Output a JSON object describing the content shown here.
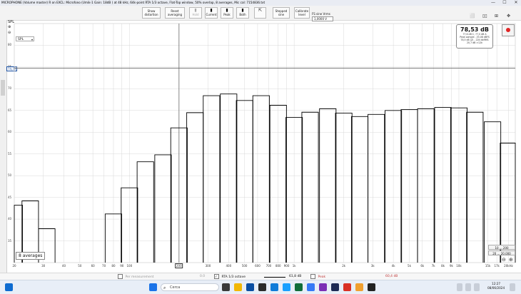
{
  "window": {
    "title": "MICROPHONE (Volume master) R on EXCL: Microfono (Umik-1 Gain: 18dB ) at 48 kHz, 64k-point RTA 1/3 octave, Flat-Top window, 50% overlap, 8 averages, Mic cal: 7154836.txt"
  },
  "toolbar": {
    "show_distortion": "Show distortion",
    "reset_averaging": "Reset averaging",
    "hold": "Hold",
    "current": "Current",
    "peak": "Peak",
    "both": "Both",
    "stepped_sine": "Stepped sine",
    "calibrate_level": "Calibrate level",
    "fs_sine_label": "FS sine Vrms",
    "fs_sine_value": "1,0000 V"
  },
  "axis": {
    "y_unit": "SPL",
    "y_ticks": [
      "80",
      "75",
      "70",
      "65",
      "60",
      "55",
      "50",
      "45",
      "40",
      "35"
    ],
    "x_ticks": [
      "20",
      "30",
      "40",
      "50",
      "60",
      "70",
      "80",
      "90",
      "100",
      "200",
      "300",
      "400",
      "500",
      "600",
      "700",
      "800",
      "900",
      "1k",
      "2k",
      "3k",
      "4k",
      "5k",
      "6k",
      "7k",
      "8k",
      "9k",
      "10k",
      "15k",
      "17k",
      "20kHz"
    ],
    "x_highlight": "200",
    "cursor_value": "74,72"
  },
  "overlay": {
    "averages": "8 averages",
    "readout_main": "78,53 dB",
    "readout_line1": "77,6 dB C, 77,0 dB A",
    "readout_line2": "Peak sample: -33,08 dBFS",
    "readout_line3": "78,5 dB (Z) - 22k dbRMS",
    "readout_line4": "20,7 dB >12k",
    "range1": "10 ... 200",
    "range2": "20 ... 20.000"
  },
  "legend": {
    "per_measurement": "Per measurement",
    "per_measurement_value": "0.0",
    "rta": "RTA 1/3 octave",
    "rta_value": "61,8 dB",
    "peak": "Peak",
    "peak_value": "60,4 dB"
  },
  "taskbar": {
    "search_placeholder": "Cerca",
    "time": "12:27",
    "date": "08/06/2024"
  },
  "chart_data": {
    "type": "bar",
    "x_scale": "log",
    "xlim": [
      20,
      22000
    ],
    "ylim": [
      30,
      85
    ],
    "grid": true,
    "reference_line_y": 74.72,
    "bands": [
      20,
      25,
      31.5,
      40,
      50,
      63,
      80,
      100,
      125,
      160,
      200,
      250,
      315,
      400,
      500,
      630,
      800,
      1000,
      1250,
      1600,
      2000,
      2500,
      3150,
      4000,
      5000,
      6300,
      8000,
      10000,
      12500,
      16000,
      20000
    ],
    "values": [
      43.2,
      44.2,
      37.8,
      null,
      null,
      null,
      41.2,
      47.2,
      53.2,
      54.8,
      61.0,
      64.5,
      68.4,
      68.8,
      67.3,
      68.4,
      66.2,
      63.4,
      64.6,
      65.4,
      64.4,
      63.6,
      64.1,
      65.0,
      65.2,
      65.4,
      65.7,
      65.6,
      64.6,
      62.4,
      57.5
    ],
    "line_color": "#000000",
    "grid_color": "#d8d8d8",
    "cursor_color": "#555555"
  }
}
